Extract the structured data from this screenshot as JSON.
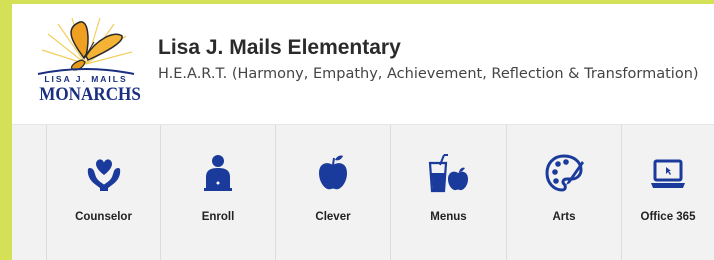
{
  "header": {
    "logo": {
      "top_text": "LISA J. MAILS",
      "bottom_text": "MONARCHS"
    },
    "school_name": "Lisa J. Mails Elementary",
    "motto": "H.E.A.R.T. (Harmony, Empathy, Achievement, Reflection & Transformation)"
  },
  "colors": {
    "accent_bar": "#d4e157",
    "icon_blue": "#1a3a9c",
    "nav_background": "#f2f2f2"
  },
  "nav": {
    "items": [
      {
        "label": "Counselor",
        "icon": "heart-hands-icon"
      },
      {
        "label": "Enroll",
        "icon": "person-laptop-icon"
      },
      {
        "label": "Clever",
        "icon": "apple-icon"
      },
      {
        "label": "Menus",
        "icon": "drink-apple-icon"
      },
      {
        "label": "Arts",
        "icon": "palette-icon"
      },
      {
        "label": "Office 365",
        "icon": "laptop-icon"
      }
    ]
  }
}
